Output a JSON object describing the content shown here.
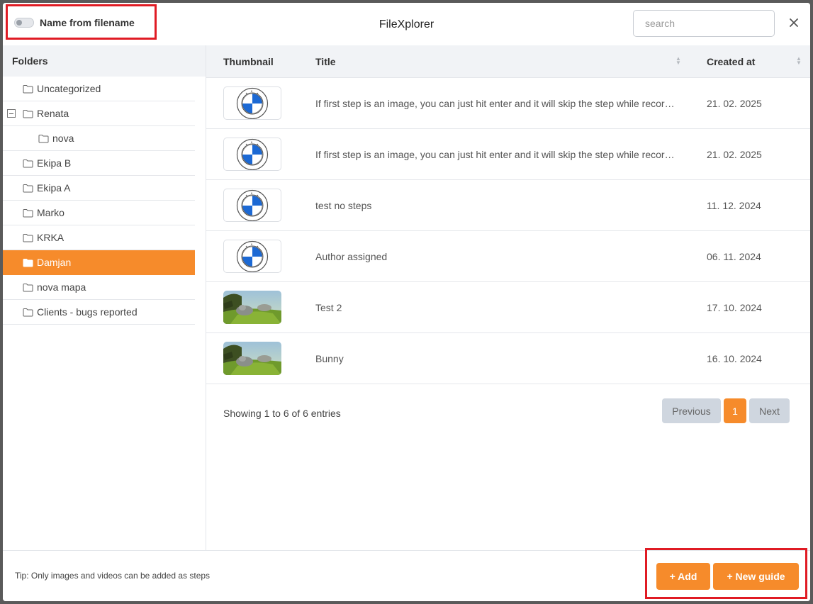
{
  "header": {
    "toggle_label": "Name from filename",
    "title": "FileXplorer",
    "search_placeholder": "search"
  },
  "sidebar": {
    "heading": "Folders",
    "folders": [
      {
        "label": "Uncategorized",
        "level": 0
      },
      {
        "label": "Renata",
        "level": 0,
        "expanded": true
      },
      {
        "label": "nova",
        "level": 1
      },
      {
        "label": "Ekipa B",
        "level": 0
      },
      {
        "label": "Ekipa A",
        "level": 0
      },
      {
        "label": "Marko",
        "level": 0
      },
      {
        "label": "KRKA",
        "level": 0
      },
      {
        "label": "Damjan",
        "level": 0,
        "active": true
      },
      {
        "label": "nova mapa",
        "level": 0
      },
      {
        "label": "Clients - bugs reported",
        "level": 0
      }
    ]
  },
  "table": {
    "columns": [
      "Thumbnail",
      "Title",
      "Created at"
    ],
    "rows": [
      {
        "thumbnail": "bmw-logo",
        "title": "If first step is an image, you can just hit enter and it will skip the step while recording",
        "created": "21. 02. 2025"
      },
      {
        "thumbnail": "bmw-logo",
        "title": "If first step is an image, you can just hit enter and it will skip the step while recording",
        "created": "21. 02. 2025"
      },
      {
        "thumbnail": "bmw-logo",
        "title": "test no steps",
        "created": "11. 12. 2024"
      },
      {
        "thumbnail": "bmw-logo",
        "title": "Author assigned",
        "created": "06. 11. 2024"
      },
      {
        "thumbnail": "bunny-scene",
        "title": "Test 2",
        "created": "17. 10. 2024"
      },
      {
        "thumbnail": "bunny-scene",
        "title": "Bunny",
        "created": "16. 10. 2024"
      }
    ],
    "info": "Showing 1 to 6 of 6 entries",
    "pagination": {
      "previous": "Previous",
      "current": "1",
      "next": "Next"
    }
  },
  "footer": {
    "tip": "Tip: Only images and videos can be added as steps",
    "add_label": "+ Add",
    "new_guide_label": "+ New guide"
  },
  "colors": {
    "accent": "#f68b2b",
    "highlight": "#e01b24",
    "bmw_blue": "#1c69d4"
  }
}
